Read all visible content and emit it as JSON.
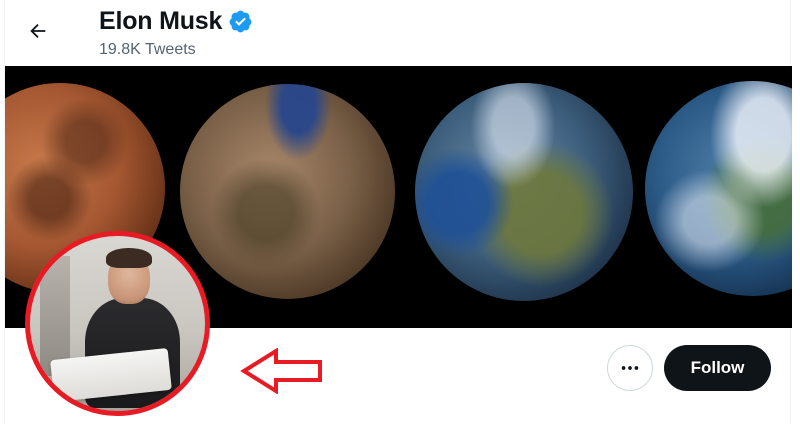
{
  "header": {
    "name": "Elon Musk",
    "tweet_count": "19.8K Tweets",
    "back_icon": "arrow-left-icon",
    "verified_icon": "verified-badge-icon"
  },
  "banner": {
    "description_icon": "planet-terraforming-banner"
  },
  "actions": {
    "more_icon": "more-horizontal-icon",
    "follow_label": "Follow"
  },
  "colors": {
    "verified": "#1d9bf0",
    "follow_bg": "#0f1419",
    "annotation": "#e81b25",
    "secondary_text": "#536471"
  }
}
